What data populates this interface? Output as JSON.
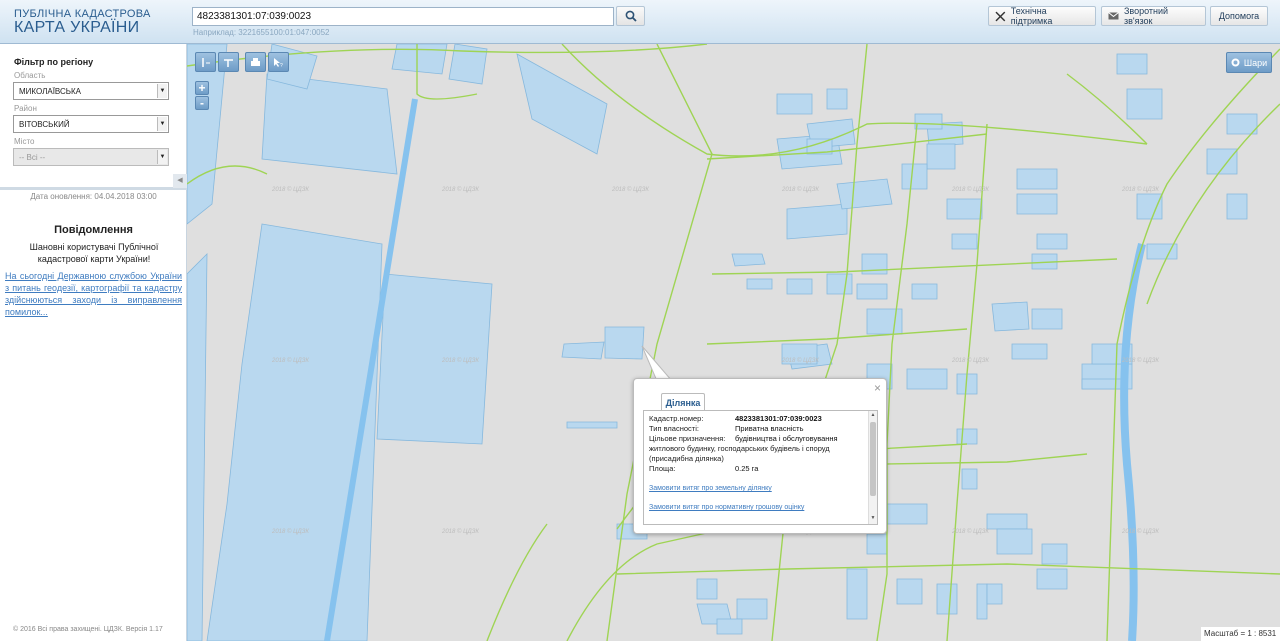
{
  "brand": {
    "line1": "ПУБЛІЧНА КАДАСТРОВА",
    "line2": "КАРТА УКРАЇНИ"
  },
  "search": {
    "value": "4823381301:07:039:0023",
    "hint": "Наприклад: 3221655100:01:047:0052"
  },
  "header_buttons": {
    "support": "Технічна підтримка",
    "feedback": "Зворотний зв'язок",
    "help": "Допомога"
  },
  "filter": {
    "title": "Фільтр по регіону",
    "region_label": "Область",
    "region_value": "МИКОЛАЇВСЬКА",
    "district_label": "Район",
    "district_value": "ВІТОВСЬКИЙ",
    "city_label": "Місто",
    "city_value": "-- Всі --"
  },
  "updated": "Дата оновлення: 04.04.2018 03:00",
  "notice": {
    "title": "Повідомлення",
    "text": "Шановні користувачі Публічної кадастрової карти України!",
    "link": "На сьогодні Державною службою України з питань геодезії, картографії та кадастру здійснюються заходи із виправлення помилок..."
  },
  "copyright": "© 2016 Всі права захищені. ЦДЗК. Версія 1.17",
  "map": {
    "layers_label": "Шари",
    "zoom_in": "+",
    "zoom_out": "-",
    "watermark": "2018 © ЦДЗК",
    "scale": "Масштаб = 1 : 8531"
  },
  "popup": {
    "tab": "Ділянка",
    "close": "×",
    "rows": [
      {
        "label": "Кадастр.номер:",
        "value": "4823381301:07:039:0023"
      },
      {
        "label": "Тип власності:",
        "value": "Приватна власність"
      },
      {
        "label": "Цільове призначення:",
        "value": "будівництва і обслуговування"
      },
      {
        "label": "",
        "value": "житлового будинку, господарських будівель і споруд (присадибна ділянка)"
      },
      {
        "label": "Площа:",
        "value": "0.25 га"
      }
    ],
    "link1": "Замовити витяг про земельну ділянку",
    "link2": "Замовити витяг про нормативну грошову оцінку"
  },
  "colors": {
    "parcel_fill": "#b9d8ef",
    "parcel_stroke": "#86b8dd",
    "road": "#9fd454",
    "river": "#86c2ee"
  }
}
